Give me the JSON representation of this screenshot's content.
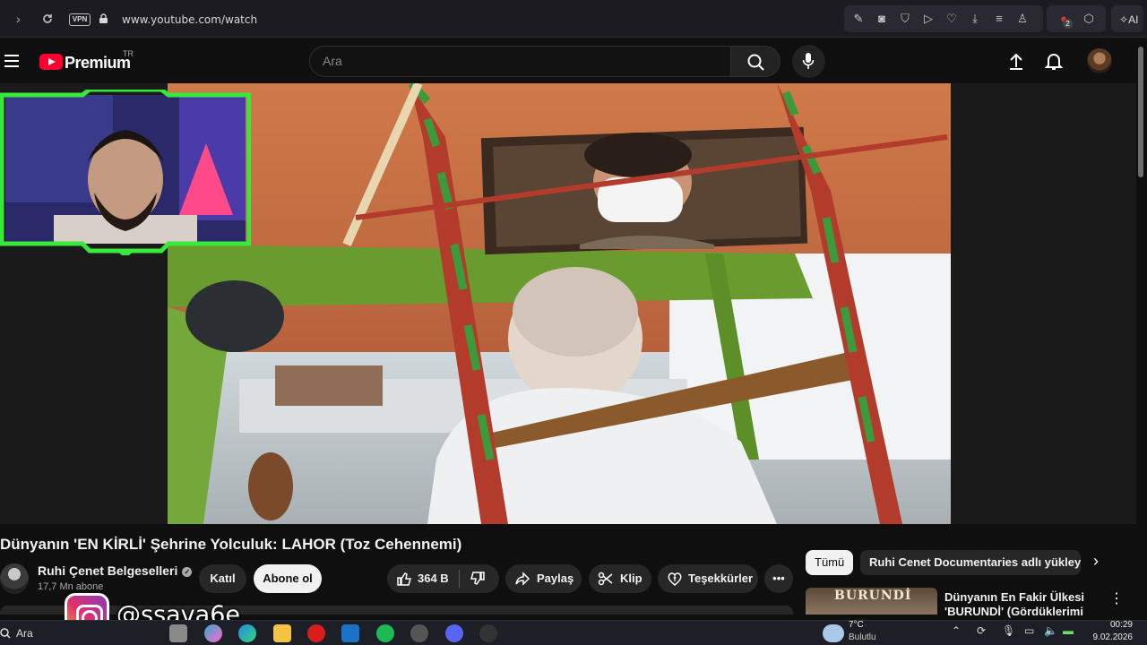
{
  "browser": {
    "url": "www.youtube.com/watch",
    "vpn_label": "VPN",
    "ai_label": "AI",
    "notification_count": "2"
  },
  "header": {
    "brand": "Premium",
    "region": "TR",
    "search_placeholder": "Ara"
  },
  "video": {
    "title": "Dünyanın 'EN KİRLİ' Şehrine Yolculuk: LAHOR (Toz Cehennemi)"
  },
  "channel": {
    "name": "Ruhi Çenet Belgeselleri",
    "subscribers": "17,7 Mn abone",
    "join_label": "Katıl",
    "subscribe_label": "Abone ol"
  },
  "actions": {
    "likes": "364 B",
    "share_label": "Paylaş",
    "clip_label": "Klip",
    "thanks_label": "Teşekkürler"
  },
  "recommendations": {
    "chips": [
      "Tümü",
      "Ruhi Cenet Documentaries adlı yükleyiciden"
    ],
    "items": [
      {
        "thumb_text": "BURUNDİ",
        "title": "Dünyanın En Fakir Ülkesi 'BURUNDİ' (Gördüklerimi Asla"
      }
    ]
  },
  "overlay": {
    "instagram_handle": "@ssava6e"
  },
  "taskbar": {
    "search_label": "Ara",
    "temperature": "7°C",
    "condition": "Bulutlu",
    "time": "00:29",
    "date": "9.02.2026"
  },
  "colors": {
    "youtube_red": "#ff0033",
    "background": "#0f0f0f",
    "pill": "#272727",
    "webcam_frame": "#38e83a"
  }
}
